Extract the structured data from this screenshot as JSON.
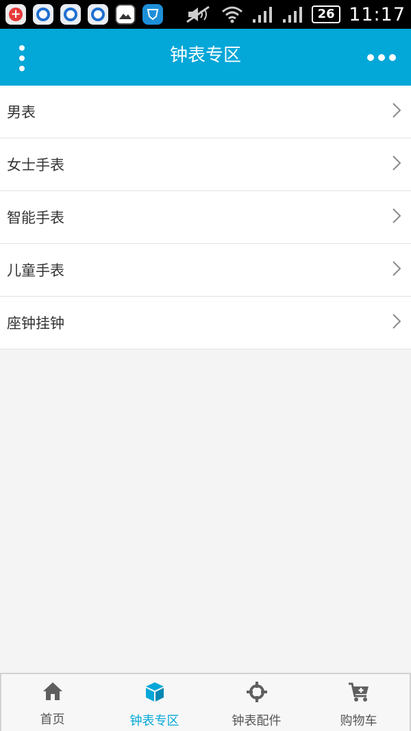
{
  "status_bar": {
    "battery_level": "26",
    "time": "11:17"
  },
  "header": {
    "title": "钟表专区"
  },
  "categories": [
    {
      "label": "男表"
    },
    {
      "label": "女士手表"
    },
    {
      "label": "智能手表"
    },
    {
      "label": "儿童手表"
    },
    {
      "label": "座钟挂钟"
    }
  ],
  "bottom_nav": {
    "items": [
      {
        "label": "首页",
        "icon": "home-icon",
        "active": false
      },
      {
        "label": "钟表专区",
        "icon": "cube-icon",
        "active": true
      },
      {
        "label": "钟表配件",
        "icon": "crosshair-icon",
        "active": false
      },
      {
        "label": "购物车",
        "icon": "cart-icon",
        "active": false
      }
    ]
  },
  "colors": {
    "accent": "#03a7d8",
    "status_bar": "#000000",
    "background": "#f4f4f4",
    "inactive_nav": "#555555"
  }
}
